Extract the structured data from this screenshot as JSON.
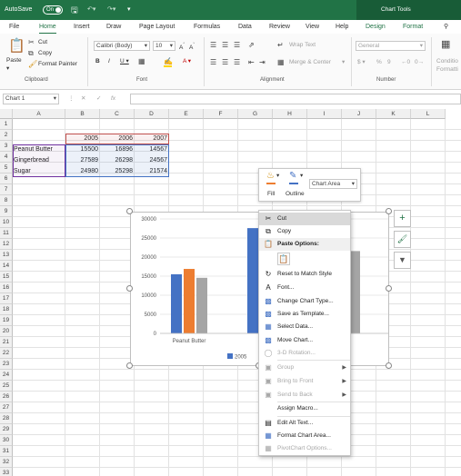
{
  "titlebar": {
    "autosave": "AutoSave",
    "toggle": "On",
    "context_tab": "Chart Tools"
  },
  "tabs": [
    "File",
    "Home",
    "Insert",
    "Draw",
    "Page Layout",
    "Formulas",
    "Data",
    "Review",
    "View",
    "Help",
    "Design",
    "Format"
  ],
  "ribbon": {
    "paste": "Paste",
    "cut": "Cut",
    "copy": "Copy",
    "format_painter": "Format Painter",
    "font_name": "Calibri (Body)",
    "font_size": "10",
    "wrap_text": "Wrap Text",
    "merge_center": "Merge & Center",
    "number_format": "General",
    "conditional": "Conditio",
    "formatting": "Formatti",
    "groups": {
      "clipboard": "Clipboard",
      "font": "Font",
      "alignment": "Alignment",
      "number": "Number"
    }
  },
  "formula_bar": {
    "name_box": "Chart 1",
    "fx": "fx"
  },
  "columns": [
    "A",
    "B",
    "C",
    "D",
    "E",
    "F",
    "G",
    "H",
    "I",
    "J",
    "K",
    "L"
  ],
  "rows": [
    "1",
    "2",
    "3",
    "4",
    "5",
    "6",
    "7",
    "8",
    "9",
    "10",
    "11",
    "12",
    "13",
    "14",
    "15",
    "16",
    "17",
    "18",
    "19",
    "20",
    "21",
    "22",
    "23",
    "24",
    "25",
    "26",
    "27",
    "28",
    "29",
    "30",
    "31",
    "32",
    "33"
  ],
  "cells": {
    "headers": [
      "2005",
      "2006",
      "2007"
    ],
    "labels": [
      "Peanut Butter",
      "Gingerbread",
      "Sugar"
    ],
    "values": [
      [
        "15500",
        "16896",
        "14567"
      ],
      [
        "27589",
        "26298",
        "24567"
      ],
      [
        "24980",
        "25298",
        "21574"
      ]
    ]
  },
  "chart_data": {
    "type": "bar",
    "categories": [
      "Peanut Butter",
      "Gingerbread",
      "Sugar"
    ],
    "series": [
      {
        "name": "2005",
        "values": [
          15500,
          27589,
          24980
        ],
        "color": "#4472c4"
      },
      {
        "name": "2006",
        "values": [
          16896,
          26298,
          25298
        ],
        "color": "#ed7d31"
      },
      {
        "name": "2007",
        "values": [
          14567,
          24567,
          21574
        ],
        "color": "#a5a5a5"
      }
    ],
    "ylim": [
      0,
      30000
    ],
    "yticks": [
      "30000",
      "25000",
      "20000",
      "15000",
      "10000",
      "5000",
      "0"
    ],
    "visible_category_labels": [
      "Peanut Butter",
      "Gi"
    ],
    "legend": {
      "position": "bottom",
      "visible_label": "2005"
    }
  },
  "mini_toolbar": {
    "fill": "Fill",
    "outline": "Outline",
    "selector": "Chart Area"
  },
  "context_menu": [
    {
      "label": "Cut",
      "icon": "scissors-icon",
      "state": "highlighted"
    },
    {
      "label": "Copy",
      "icon": "copy-icon",
      "state": "normal"
    },
    {
      "label": "Paste Options:",
      "icon": "paste-icon",
      "state": "header"
    },
    {
      "label": "",
      "icon": "paste-option-icon",
      "state": "icon-row"
    },
    {
      "label": "Reset to Match Style",
      "icon": "reset-icon",
      "state": "normal"
    },
    {
      "label": "Font...",
      "icon": "font-icon",
      "state": "normal"
    },
    {
      "label": "Change Chart Type...",
      "icon": "chart-type-icon",
      "state": "normal"
    },
    {
      "label": "Save as Template...",
      "icon": "template-icon",
      "state": "normal"
    },
    {
      "label": "Select Data...",
      "icon": "select-data-icon",
      "state": "normal"
    },
    {
      "label": "Move Chart...",
      "icon": "move-chart-icon",
      "state": "normal"
    },
    {
      "label": "3-D Rotation...",
      "icon": "rotation-icon",
      "state": "disabled"
    },
    {
      "label": "Group",
      "icon": "group-icon",
      "state": "disabled-sub"
    },
    {
      "label": "Bring to Front",
      "icon": "bring-front-icon",
      "state": "disabled-sub"
    },
    {
      "label": "Send to Back",
      "icon": "send-back-icon",
      "state": "disabled-sub"
    },
    {
      "label": "Assign Macro...",
      "icon": "",
      "state": "normal"
    },
    {
      "label": "Edit Alt Text...",
      "icon": "alt-text-icon",
      "state": "normal"
    },
    {
      "label": "Format Chart Area...",
      "icon": "format-area-icon",
      "state": "normal"
    },
    {
      "label": "PivotChart Options...",
      "icon": "pivot-icon",
      "state": "disabled"
    }
  ],
  "side_buttons": [
    "plus-icon",
    "brush-icon",
    "filter-icon"
  ],
  "colors": {
    "excel_green": "#217346",
    "selection_red": "#c0504d",
    "selection_blue": "#4472c4"
  }
}
